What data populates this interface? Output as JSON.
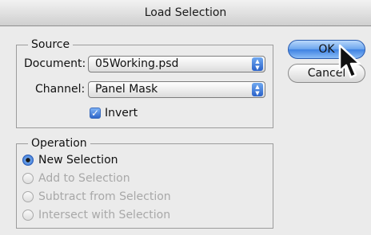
{
  "window": {
    "title": "Load Selection"
  },
  "source": {
    "title": "Source",
    "document_label": "Document:",
    "document_value": "05Working.psd",
    "channel_label": "Channel:",
    "channel_value": "Panel Mask",
    "invert_label": "Invert",
    "invert_checked": true
  },
  "operation": {
    "title": "Operation",
    "options": [
      {
        "label": "New Selection",
        "selected": true,
        "enabled": true
      },
      {
        "label": "Add to Selection",
        "selected": false,
        "enabled": false
      },
      {
        "label": "Subtract from Selection",
        "selected": false,
        "enabled": false
      },
      {
        "label": "Intersect with Selection",
        "selected": false,
        "enabled": false
      }
    ]
  },
  "buttons": {
    "ok": "OK",
    "cancel": "Cancel"
  },
  "icons": {
    "popup": "up-down-arrows-icon",
    "cursor": "mouse-pointer-icon",
    "check": "checkmark-icon"
  },
  "colors": {
    "accent": "#3f82e2"
  }
}
